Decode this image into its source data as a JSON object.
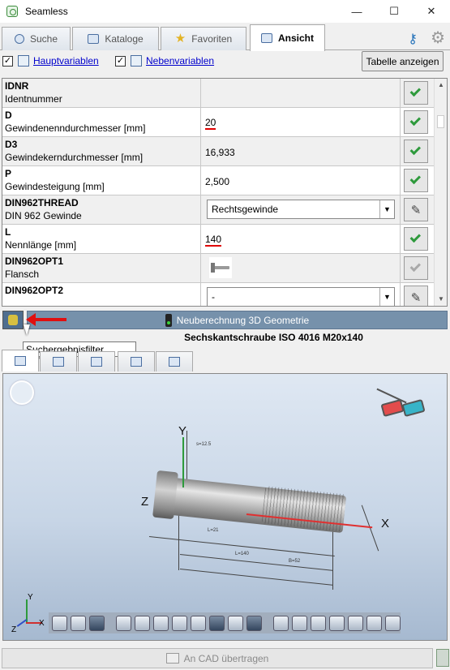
{
  "window": {
    "title": "Seamless",
    "minimize": "—",
    "maximize": "☐",
    "close": "✕"
  },
  "tabs": [
    {
      "label": "Suche"
    },
    {
      "label": "Kataloge"
    },
    {
      "label": "Favoriten"
    },
    {
      "label": "Ansicht"
    }
  ],
  "filters": {
    "hauptvariablen": {
      "label": "Hauptvariablen",
      "checked": true
    },
    "nebenvariablen": {
      "label": "Nebenvariablen",
      "checked": true
    },
    "show_table": "Tabelle anzeigen"
  },
  "variables": [
    {
      "code": "IDNR",
      "desc": "Identnummer",
      "value": "",
      "action": "check"
    },
    {
      "code": "D",
      "desc": "Gewindenenndurchmesser [mm]",
      "value": "20",
      "highlight": true,
      "action": "check"
    },
    {
      "code": "D3",
      "desc": "Gewindekerndurchmesser [mm]",
      "value": "16,933",
      "action": "check"
    },
    {
      "code": "P",
      "desc": "Gewindesteigung [mm]",
      "value": "2,500",
      "action": "check"
    },
    {
      "code": "DIN962THREAD",
      "desc": "DIN 962 Gewinde",
      "value": "Rechtsgewinde",
      "type": "select",
      "action": "edit"
    },
    {
      "code": "L",
      "desc": "Nennlänge [mm]",
      "value": "140",
      "highlight": true,
      "action": "check"
    },
    {
      "code": "DIN962OPT1",
      "desc": "Flansch",
      "value": "",
      "type": "image",
      "action": "check-dim"
    },
    {
      "code": "DIN962OPT2",
      "desc": "",
      "value": "-",
      "type": "select",
      "action": "edit"
    }
  ],
  "toolbar": {
    "recalc_label": "Neuberechnung 3D Geometrie",
    "tooltip": "Suchergebnisfilter an/aus"
  },
  "part_title": "Sechskantschraube ISO 4016 M20x140",
  "viewport": {
    "axes": {
      "x": "X",
      "y": "Y",
      "z": "Z"
    },
    "dims": {
      "l140": "L=140",
      "b52": "B=52",
      "l21": "L=21",
      "s12": "s=12.5"
    }
  },
  "bottom": {
    "cad_button": "An CAD übertragen"
  }
}
